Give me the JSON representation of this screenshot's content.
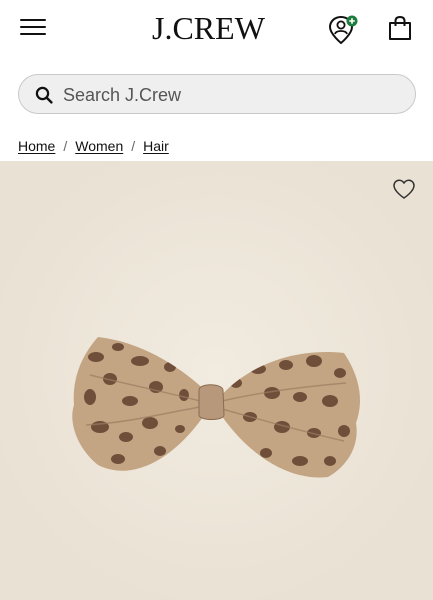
{
  "header": {
    "logo_text": "J.CREW",
    "menu_icon": "hamburger-menu-icon",
    "account_icon": "account-location-icon",
    "bag_icon": "shopping-bag-icon"
  },
  "search": {
    "placeholder": "Search J.Crew",
    "value": ""
  },
  "breadcrumb": {
    "items": [
      "Home",
      "Women",
      "Hair"
    ],
    "separator": "/"
  },
  "product": {
    "image_alt": "Leopard print hair bow",
    "wishlist_icon": "heart-icon"
  },
  "colors": {
    "accent_green": "#1e7d3c",
    "image_background": "#ece4d7"
  }
}
